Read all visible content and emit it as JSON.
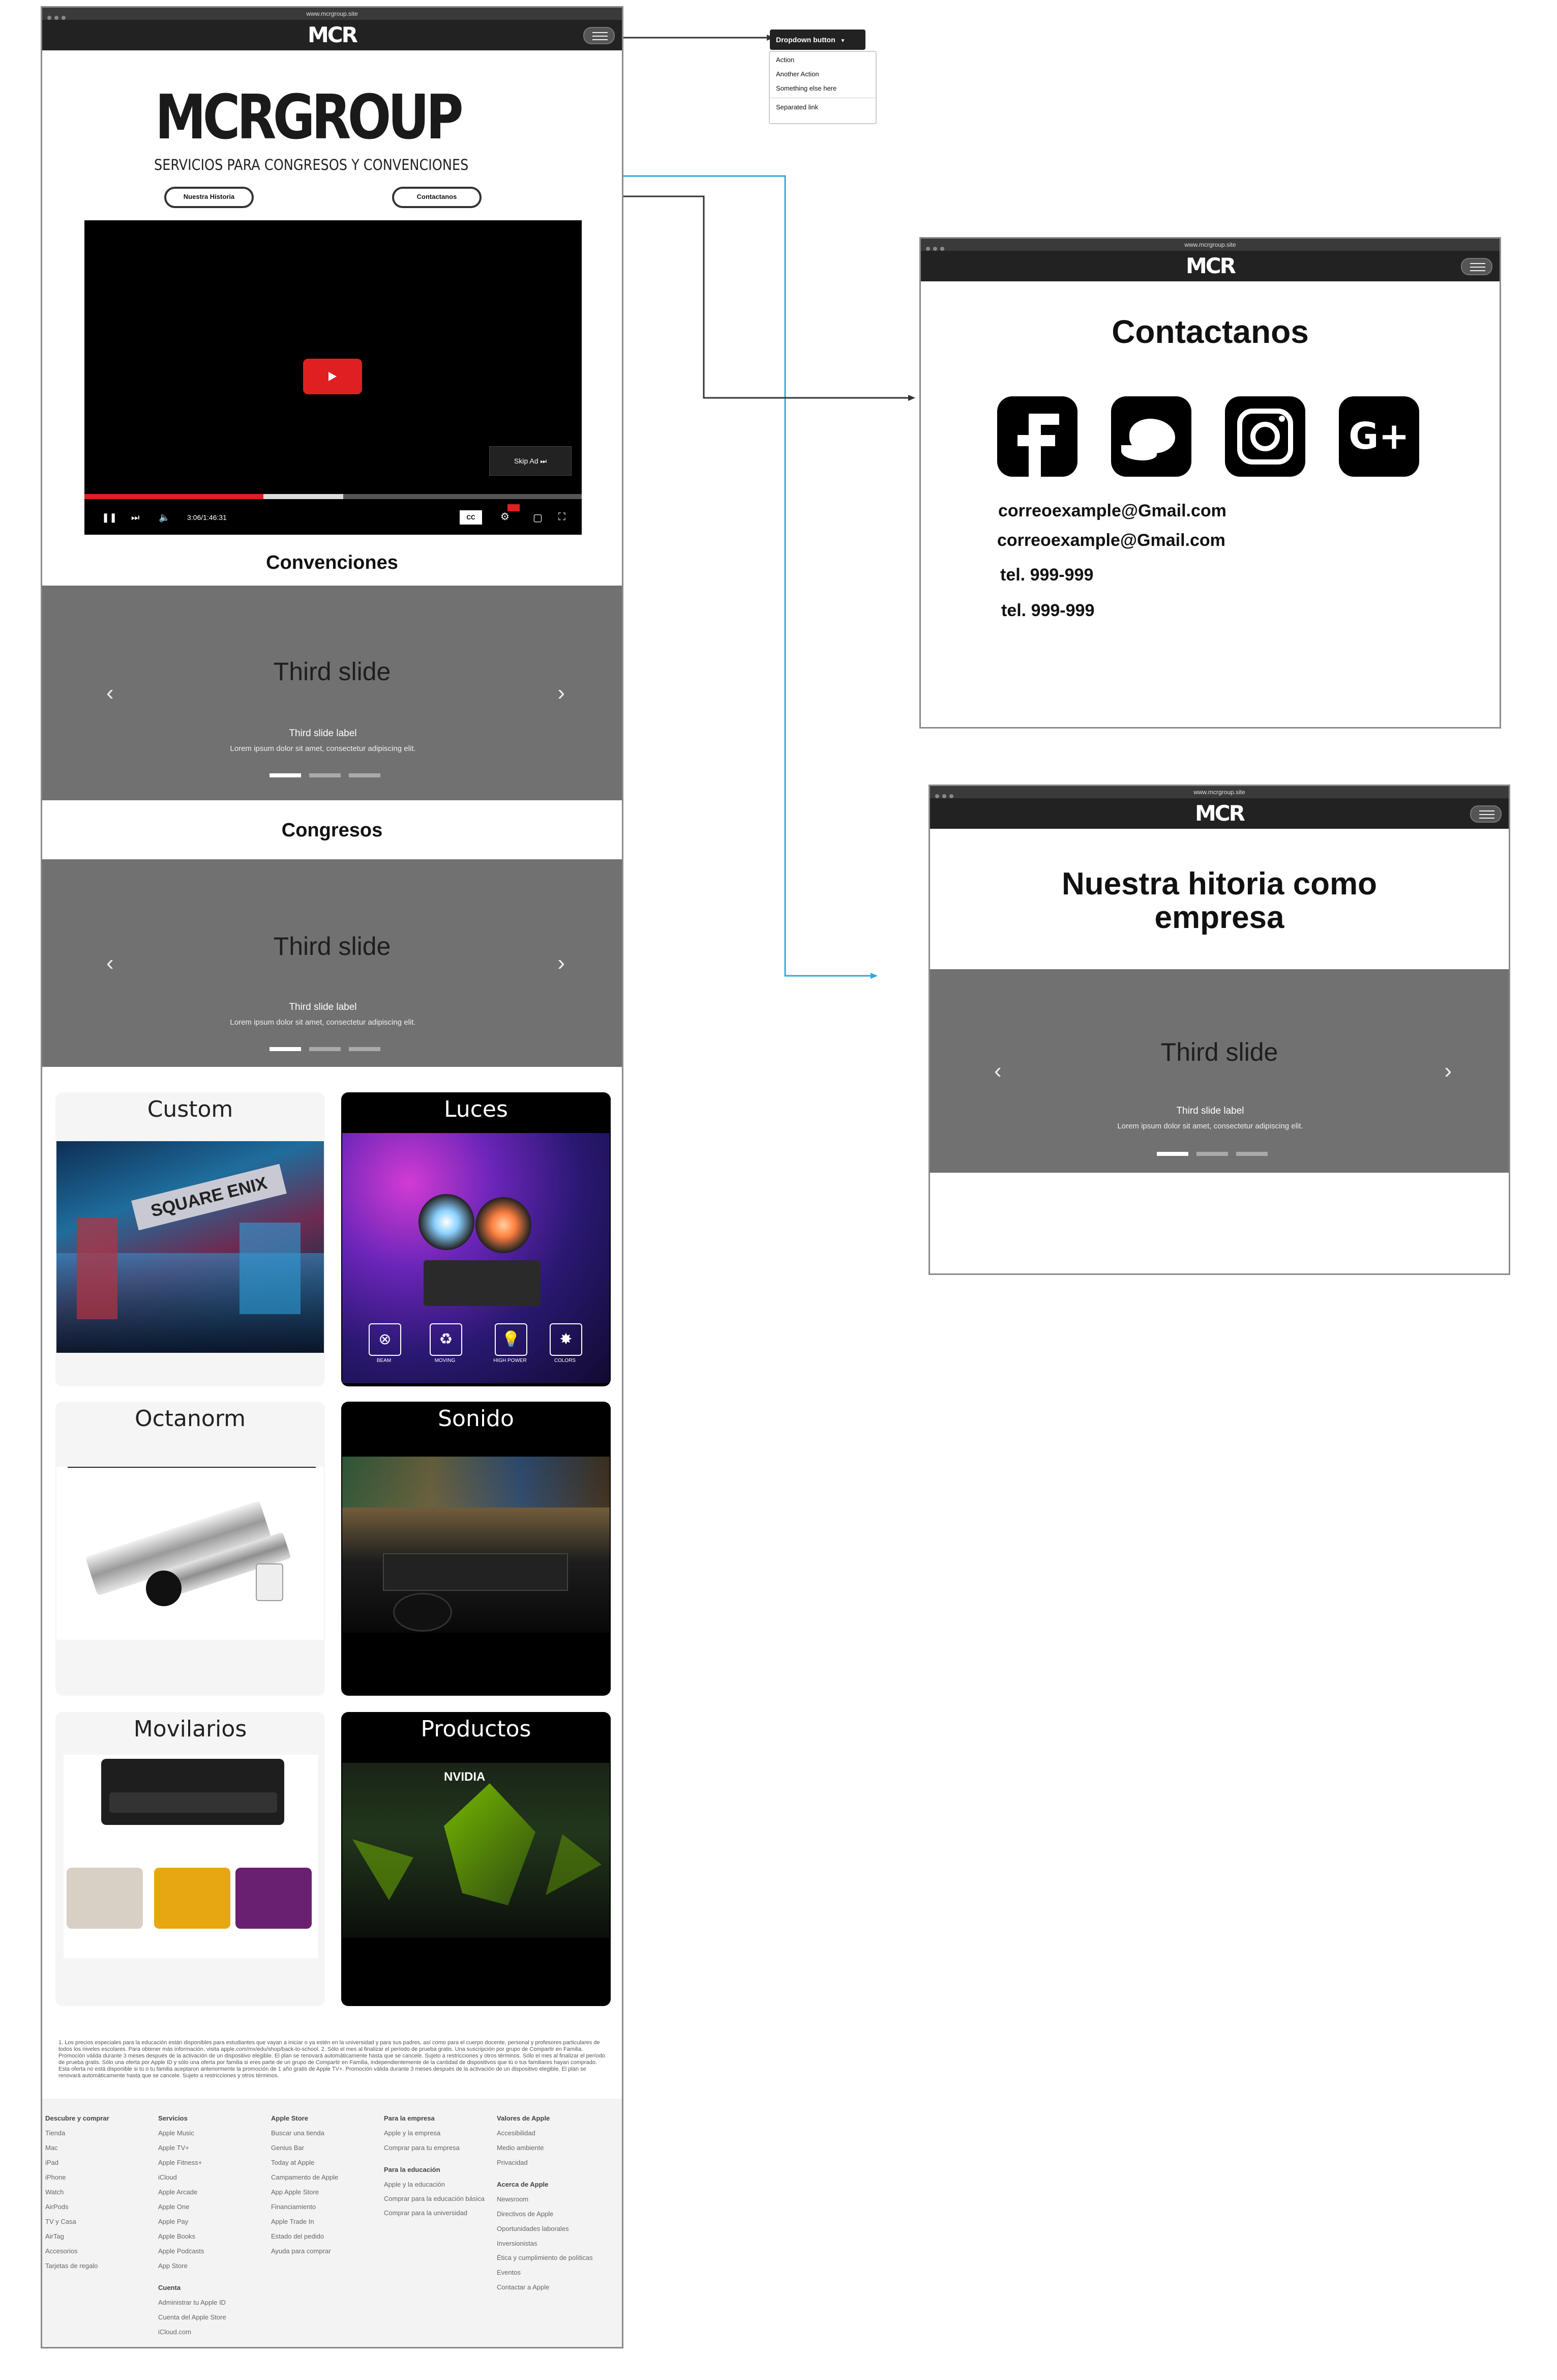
{
  "main_frame": {
    "url": "www.mcrgroup.site",
    "logo_small": "MCR",
    "logo_big": "MCRGROUP",
    "logo_tagline": "SERVICIOS PARA CONGRESOS Y CONVENCIONES",
    "buttons": {
      "history": "Nuestra Historia",
      "contact": "Contactanos"
    },
    "video": {
      "skip_label": "Skip Ad",
      "time": "3:06/1:46:31",
      "cc": "CC",
      "progress_played": 0.36,
      "progress_buffered": 0.52
    },
    "sections": [
      {
        "title": "Convenciones",
        "slide_title": "Third slide",
        "slide_label": "Third slide label",
        "slide_text": "Lorem ipsum dolor sit amet, consectetur adipiscing elit."
      },
      {
        "title": "Congresos",
        "slide_title": "Third slide",
        "slide_label": "Third slide label",
        "slide_text": "Lorem ipsum dolor sit amet, consectetur adipiscing elit."
      }
    ],
    "arrows": {
      "prev": "‹",
      "next": "›"
    },
    "cards": [
      {
        "title": "Custom",
        "theme": "light"
      },
      {
        "title": "Luces",
        "theme": "dark",
        "icons": [
          "BEAM",
          "MOVING",
          "HIGH POWER",
          "COLORS"
        ]
      },
      {
        "title": "Octanorm",
        "theme": "light"
      },
      {
        "title": "Sonido",
        "theme": "dark"
      },
      {
        "title": "Movilarios",
        "theme": "light"
      },
      {
        "title": "Productos",
        "theme": "dark"
      }
    ],
    "booth_sign": "SQUARE ENIX",
    "nvidia_sign": "NVIDIA",
    "fineprint": "1. Los precios especiales para la educación están disponibles para estudiantes que vayan a iniciar o ya estén en la universidad y para sus padres, así como para el cuerpo docente, personal y profesores particulares de todos los niveles escolares. Para obtener más información, visita apple.com/mx/edu/shop/back-to-school. 2. Sólo el mes al finalizar el período de prueba gratis. Una suscripción por grupo de Compartir en Familia. Promoción válida durante 3 meses después de la activación de un dispositivo elegible. El plan se renovará automáticamente hasta que se cancele. Sujeto a restricciones y otros términos. Sólo el mes al finalizar el período de prueba gratis. Sólo una oferta por Apple ID y sólo una oferta por familia si eres parte de un grupo de Compartir en Familia, independientemente de la cantidad de dispositivos que tú o tus familiares hayan comprado. Esta oferta no está disponible si tú o tu familia aceptaron anteriormente la promoción de 1 año gratis de Apple TV+. Promoción válida durante 3 meses después de la activación de un dispositivo elegible. El plan se renovará automáticamente hasta que se cancele. Sujeto a restricciones y otros términos.",
    "footer": [
      {
        "groups": [
          {
            "heading": "Descubre y comprar",
            "items": [
              "Tienda",
              "Mac",
              "iPad",
              "iPhone",
              "Watch",
              "AirPods",
              "TV y Casa",
              "AirTag",
              "Accesorios",
              "Tarjetas de regalo"
            ]
          }
        ]
      },
      {
        "groups": [
          {
            "heading": "Servicios",
            "items": [
              "Apple Music",
              "Apple TV+",
              "Apple Fitness+",
              "iCloud",
              "Apple Arcade",
              "Apple One",
              "Apple Pay",
              "Apple Books",
              "Apple Podcasts",
              "App Store"
            ]
          },
          {
            "heading": "Cuenta",
            "items": [
              "Administrar tu Apple ID",
              "Cuenta del Apple Store",
              "iCloud.com"
            ]
          }
        ]
      },
      {
        "groups": [
          {
            "heading": "Apple Store",
            "items": [
              "Buscar una tienda",
              "Genius Bar",
              "Today at Apple",
              "Campamento de Apple",
              "App Apple Store",
              "Financiamiento",
              "Apple Trade In",
              "Estado del pedido",
              "Ayuda para comprar"
            ]
          }
        ]
      },
      {
        "groups": [
          {
            "heading": "Para la empresa",
            "items": [
              "Apple y la empresa",
              "Comprar para tu empresa"
            ]
          },
          {
            "heading": "Para la educación",
            "items": [
              "Apple y la educación",
              "Comprar para la educación básica",
              "Comprar para la universidad"
            ]
          }
        ]
      },
      {
        "groups": [
          {
            "heading": "Valores de Apple",
            "items": [
              "Accesibilidad",
              "Medio ambiente",
              "Privacidad"
            ]
          },
          {
            "heading": "Acerca de Apple",
            "items": [
              "Newsroom",
              "Directivos de Apple",
              "Oportunidades laborales",
              "Inversionistas",
              "Ética y cumplimiento de políticas",
              "Eventos",
              "Contactar a Apple"
            ]
          }
        ]
      }
    ]
  },
  "dropdown": {
    "button": "Dropdown button",
    "items": [
      "Action",
      "Another Action",
      "Something else here"
    ],
    "separated": "Separated link"
  },
  "contact_frame": {
    "url": "www.mcrgroup.site",
    "logo_small": "MCR",
    "title": "Contactanos",
    "social_icons": [
      "facebook-icon",
      "twitter-icon",
      "instagram-icon",
      "google-plus-icon"
    ],
    "lines": [
      "correoexample@Gmail.com",
      "correoexample@Gmail.com",
      "tel. 999-999",
      "tel. 999-999"
    ]
  },
  "history_frame": {
    "url": "www.mcrgroup.site",
    "logo_small": "MCR",
    "title_line1": "Nuestra hitoria como",
    "title_line2": "empresa",
    "slide_title": "Third slide",
    "slide_label": "Third slide label",
    "slide_text": "Lorem ipsum dolor sit amet, consectetur adipiscing elit."
  },
  "colors": {
    "navbar": "#222222",
    "slide": "#717171",
    "youtube_red": "#e02020",
    "connector_blue": "#29a9e0",
    "connector_dark": "#333333"
  }
}
